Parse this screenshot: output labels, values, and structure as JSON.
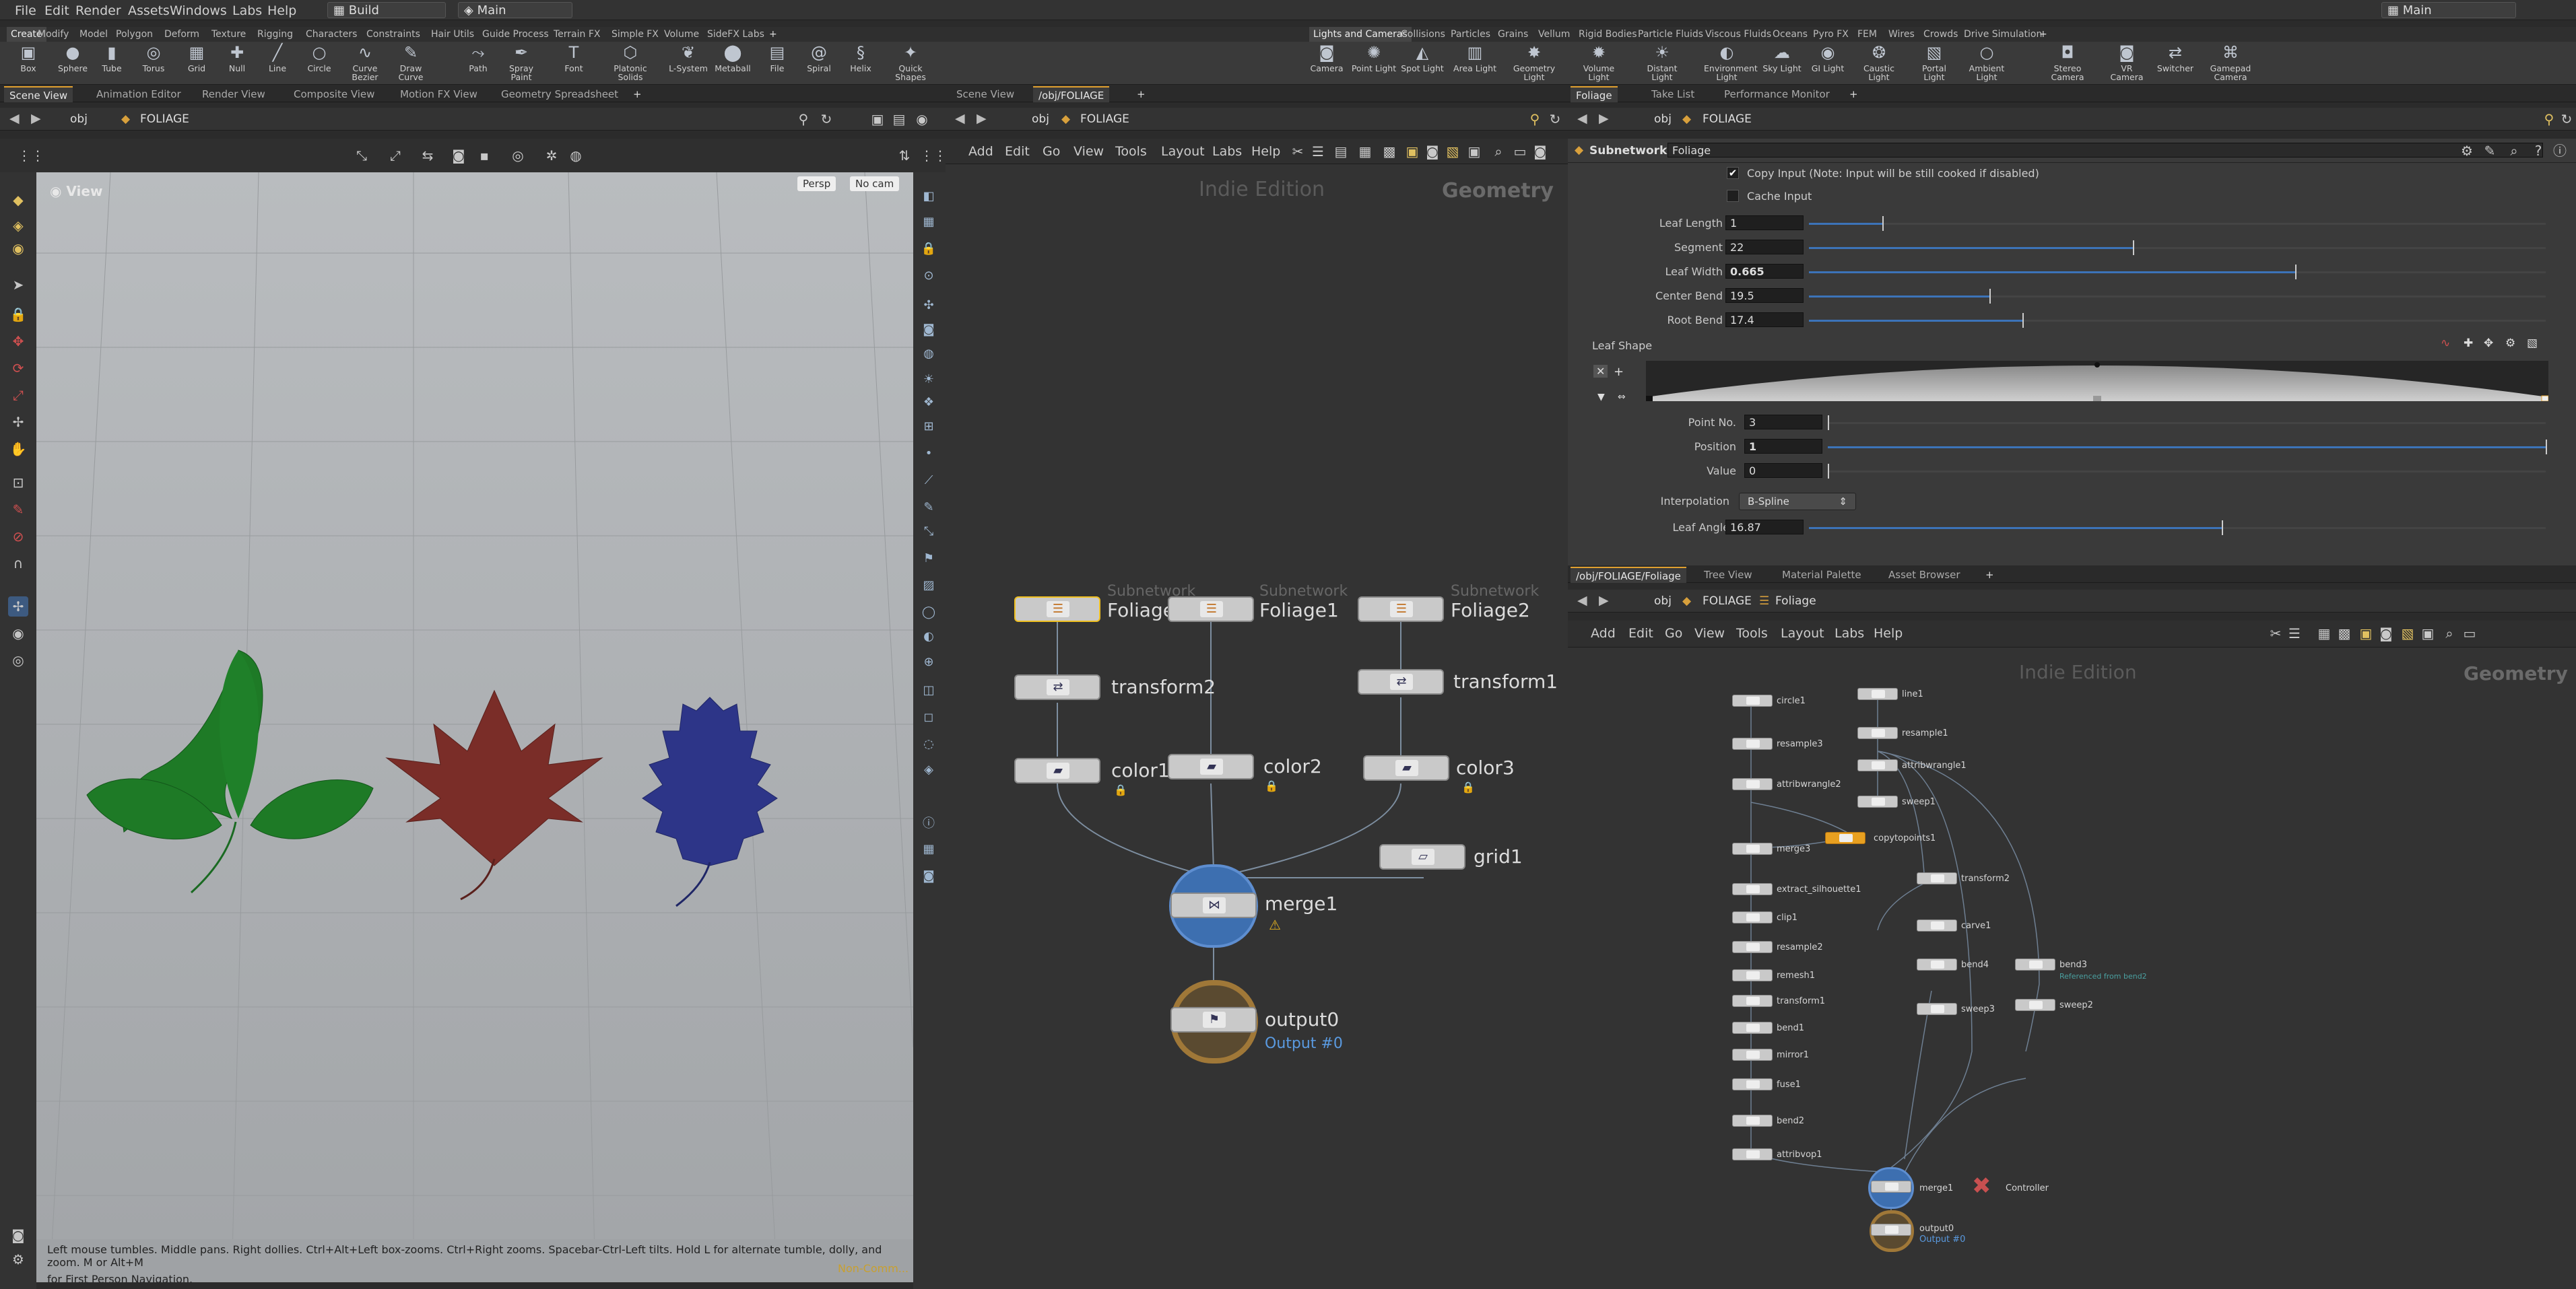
{
  "menubar": {
    "items": [
      "File",
      "Edit",
      "Render",
      "Assets",
      "Windows",
      "Labs",
      "Help"
    ],
    "desktop": "Build",
    "context": "Main",
    "right_desktop": "Main"
  },
  "shelf_left": {
    "tabs": [
      "Create",
      "Modify",
      "Model",
      "Polygon",
      "Deform",
      "Texture",
      "Rigging",
      "Characters",
      "Constraints",
      "Hair Utils",
      "Guide Process",
      "Terrain FX",
      "Simple FX",
      "Volume",
      "SideFX Labs"
    ],
    "tools": [
      {
        "label": "Box",
        "icon": "box-icon",
        "glyph": "▣"
      },
      {
        "label": "Sphere",
        "icon": "sphere-icon",
        "glyph": "●"
      },
      {
        "label": "Tube",
        "icon": "tube-icon",
        "glyph": "▮"
      },
      {
        "label": "Torus",
        "icon": "torus-icon",
        "glyph": "◎"
      },
      {
        "label": "Grid",
        "icon": "grid-icon",
        "glyph": "▦"
      },
      {
        "label": "Null",
        "icon": "null-icon",
        "glyph": "✚"
      },
      {
        "label": "Line",
        "icon": "line-icon",
        "glyph": "╱"
      },
      {
        "label": "Circle",
        "icon": "circle-icon",
        "glyph": "○"
      },
      {
        "label": "Curve Bezier",
        "icon": "curve-bezier-icon",
        "glyph": "∿"
      },
      {
        "label": "Draw Curve",
        "icon": "draw-curve-icon",
        "glyph": "✎"
      },
      {
        "label": "Path",
        "icon": "path-icon",
        "glyph": "⤳"
      },
      {
        "label": "Spray Paint",
        "icon": "spray-paint-icon",
        "glyph": "✒"
      },
      {
        "label": "Font",
        "icon": "font-icon",
        "glyph": "T"
      },
      {
        "label": "Platonic Solids",
        "icon": "platonic-icon",
        "glyph": "⬡"
      },
      {
        "label": "L-System",
        "icon": "lsystem-icon",
        "glyph": "❦"
      },
      {
        "label": "Metaball",
        "icon": "metaball-icon",
        "glyph": "⬤"
      },
      {
        "label": "File",
        "icon": "file-icon",
        "glyph": "▤"
      },
      {
        "label": "Spiral",
        "icon": "spiral-icon",
        "glyph": "@"
      },
      {
        "label": "Helix",
        "icon": "helix-icon",
        "glyph": "§"
      },
      {
        "label": "Quick Shapes",
        "icon": "quick-shapes-icon",
        "glyph": "✦"
      }
    ]
  },
  "shelf_right": {
    "tabs": [
      "Lights and Cameras",
      "Collisions",
      "Particles",
      "Grains",
      "Vellum",
      "Rigid Bodies",
      "Particle Fluids",
      "Viscous Fluids",
      "Oceans",
      "Pyro FX",
      "FEM",
      "Wires",
      "Crowds",
      "Drive Simulation"
    ],
    "tools": [
      {
        "label": "Camera",
        "icon": "camera-icon",
        "glyph": "◙"
      },
      {
        "label": "Point Light",
        "icon": "point-light-icon",
        "glyph": "✺"
      },
      {
        "label": "Spot Light",
        "icon": "spot-light-icon",
        "glyph": "◭"
      },
      {
        "label": "Area Light",
        "icon": "area-light-icon",
        "glyph": "▥"
      },
      {
        "label": "Geometry Light",
        "icon": "geometry-light-icon",
        "glyph": "✸"
      },
      {
        "label": "Volume Light",
        "icon": "volume-light-icon",
        "glyph": "✹"
      },
      {
        "label": "Distant Light",
        "icon": "distant-light-icon",
        "glyph": "☀"
      },
      {
        "label": "Environment Light",
        "icon": "environment-light-icon",
        "glyph": "◐"
      },
      {
        "label": "Sky Light",
        "icon": "sky-light-icon",
        "glyph": "☁"
      },
      {
        "label": "GI Light",
        "icon": "gi-light-icon",
        "glyph": "◉"
      },
      {
        "label": "Caustic Light",
        "icon": "caustic-light-icon",
        "glyph": "❂"
      },
      {
        "label": "Portal Light",
        "icon": "portal-light-icon",
        "glyph": "▧"
      },
      {
        "label": "Ambient Light",
        "icon": "ambient-light-icon",
        "glyph": "○"
      },
      {
        "label": "Stereo Camera",
        "icon": "stereo-camera-icon",
        "glyph": "◘"
      },
      {
        "label": "VR Camera",
        "icon": "vr-camera-icon",
        "glyph": "◙"
      },
      {
        "label": "Switcher",
        "icon": "switcher-icon",
        "glyph": "⇄"
      },
      {
        "label": "Gamepad Camera",
        "icon": "gamepad-camera-icon",
        "glyph": "⌘"
      }
    ]
  },
  "scene_pane": {
    "tabs": [
      "Scene View",
      "Animation Editor",
      "Render View",
      "Composite View",
      "Motion FX View",
      "Geometry Spreadsheet"
    ],
    "path": [
      "obj",
      "FOLIAGE"
    ],
    "view_label": "View",
    "persp": "Persp",
    "cam": "No cam",
    "status_line1": "Left mouse tumbles. Middle pans. Right dollies. Ctrl+Alt+Left box-zooms. Ctrl+Right zooms. Spacebar-Ctrl-Left tilts. Hold L for alternate tumble, dolly, and zoom. M or Alt+M",
    "status_line2": "for First Person Navigation.",
    "non_commercial": "Non-Comm..."
  },
  "network_pane": {
    "tabs": [
      "Scene View",
      "/obj/FOLIAGE"
    ],
    "path": [
      "obj",
      "FOLIAGE"
    ],
    "menu": [
      "Add",
      "Edit",
      "Go",
      "View",
      "Tools",
      "Layout",
      "Labs",
      "Help"
    ],
    "edition": "Indie Edition",
    "context": "Geometry",
    "nodes": {
      "foliage": "Foliage",
      "foliage1": "Foliage1",
      "foliage2": "Foliage2",
      "sub": "Subnetwork",
      "transform2": "transform2",
      "transform1": "transform1",
      "color1": "color1",
      "color2": "color2",
      "color3": "color3",
      "grid1": "grid1",
      "merge1": "merge1",
      "output0": "output0",
      "output_sub": "Output #0"
    }
  },
  "params_pane": {
    "tabs": [
      "Foliage",
      "Take List",
      "Performance Monitor"
    ],
    "path": [
      "obj",
      "FOLIAGE"
    ],
    "type": "Subnetwork",
    "name": "Foliage",
    "copy_input": "Copy Input (Note: Input will be still cooked if disabled)",
    "cache_input": "Cache Input",
    "params": [
      {
        "label": "Leaf Length",
        "value": "1",
        "frac": 0.1
      },
      {
        "label": "Segment",
        "value": "22",
        "frac": 0.44
      },
      {
        "label": "Leaf Width",
        "value": "0.665",
        "frac": 0.66
      },
      {
        "label": "Center Bend",
        "value": "19.5",
        "frac": 0.245
      },
      {
        "label": "Root Bend",
        "value": "17.4",
        "frac": 0.29
      }
    ],
    "leaf_shape": "Leaf Shape",
    "ramp": [
      {
        "label": "Point No.",
        "value": "3",
        "frac": 0.0
      },
      {
        "label": "Position",
        "value": "1",
        "frac": 1.0
      },
      {
        "label": "Value",
        "value": "0",
        "frac": 0.0
      }
    ],
    "interp_label": "Interpolation",
    "interp_value": "B-Spline",
    "leaf_angle_label": "Leaf Angle",
    "leaf_angle_value": "16.87",
    "leaf_angle_frac": 0.56
  },
  "sub_network": {
    "tabs": [
      "/obj/FOLIAGE/Foliage",
      "Tree View",
      "Material Palette",
      "Asset Browser"
    ],
    "path": [
      "obj",
      "FOLIAGE",
      "Foliage"
    ],
    "menu": [
      "Add",
      "Edit",
      "Go",
      "View",
      "Tools",
      "Layout",
      "Labs",
      "Help"
    ],
    "edition": "Indie Edition",
    "context": "Geometry",
    "left_chain": [
      "circle1",
      "resample3",
      "attribwrangle2",
      "merge3",
      "extract_silhouette1",
      "clip1",
      "resample2",
      "remesh1",
      "transform1",
      "bend1",
      "mirror1",
      "fuse1",
      "bend2",
      "attribvop1"
    ],
    "right_chain": [
      "line1",
      "resample1",
      "attribwrangle1",
      "sweep1"
    ],
    "copytopoints": "copytopoints1",
    "transform2": "transform2",
    "carve1": "carve1",
    "bend4": "bend4",
    "bend3": "bend3",
    "referenced": "Referenced from bend2",
    "sweep3": "sweep3",
    "sweep2": "sweep2",
    "merge1": "merge1",
    "controller": "Controller",
    "output0": "output0",
    "output_sub": "Output #0"
  },
  "colors": {
    "leaf_green": "#1e7a26",
    "leaf_red": "#7a2d28",
    "leaf_blue": "#2d3588",
    "accent": "#e0a030",
    "wire": "#7d8ea0"
  }
}
